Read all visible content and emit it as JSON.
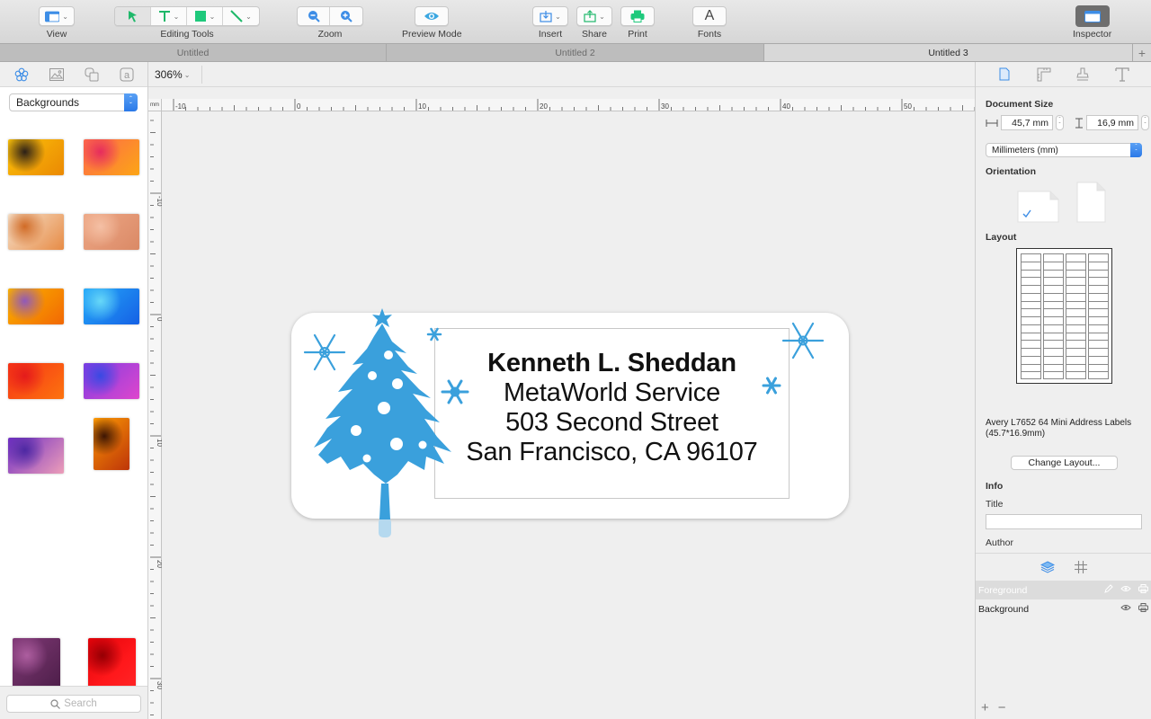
{
  "toolbar": {
    "groups": [
      {
        "label": "View"
      },
      {
        "label": "Editing Tools"
      },
      {
        "label": "Zoom"
      },
      {
        "label": "Preview Mode"
      },
      {
        "label": "Insert"
      },
      {
        "label": "Share"
      },
      {
        "label": "Print"
      },
      {
        "label": "Fonts"
      },
      {
        "label": "Inspector"
      }
    ],
    "fonts_glyph": "A"
  },
  "tabs": [
    {
      "label": "Untitled",
      "active": false
    },
    {
      "label": "Untitled 2",
      "active": false
    },
    {
      "label": "Untitled 3",
      "active": true
    }
  ],
  "tab_add": "+",
  "left_sidebar": {
    "tabs": [
      "shapes-flower",
      "images",
      "layers-copy",
      "text-a"
    ],
    "category": "Backgrounds",
    "thumbnails": [
      {
        "name": "yellow-orange-stroke",
        "colors": [
          "#f6c21a",
          "#e38a10",
          "#2a1f18"
        ]
      },
      {
        "name": "pink-orange-stripes",
        "colors": [
          "#f36a52",
          "#f5a623",
          "#d9305d"
        ]
      },
      {
        "name": "orange-speckle",
        "colors": [
          "#f4e3cf",
          "#e08c4d",
          "#c96c2e"
        ]
      },
      {
        "name": "peach-wood",
        "colors": [
          "#e8a98a",
          "#d48a6a",
          "#f1c1a8"
        ]
      },
      {
        "name": "yellow-purple-flame",
        "colors": [
          "#f5b40b",
          "#e76a10",
          "#8d5bb3"
        ]
      },
      {
        "name": "blue-watercolor",
        "colors": [
          "#2fa8f0",
          "#1b5fd8",
          "#6fd6f3"
        ]
      },
      {
        "name": "red-orange",
        "colors": [
          "#e8371c",
          "#f2751a",
          "#d61f1f"
        ]
      },
      {
        "name": "purple-blue",
        "colors": [
          "#7a3fd6",
          "#d54ac4",
          "#3b4ad6"
        ]
      },
      {
        "name": "purple-floral",
        "colors": [
          "#6b2fb8",
          "#e8a0b8",
          "#4b2a99"
        ]
      },
      {
        "name": "sunset-tree",
        "colors": [
          "#f39a12",
          "#b3370f",
          "#3a1606"
        ]
      },
      {
        "name": "purple-crosshatch",
        "colors": [
          "#7b3b73",
          "#4a1f46",
          "#a8609b"
        ]
      },
      {
        "name": "red-silk",
        "colors": [
          "#d4060d",
          "#ff2a2a",
          "#8a0006"
        ]
      }
    ],
    "search_placeholder": "Search"
  },
  "canvas": {
    "zoom": "306%",
    "ruler_unit": "mm",
    "h_ruler_labels": [
      "-10",
      "0",
      "10",
      "20",
      "30",
      "40",
      "50"
    ],
    "v_ruler_labels": [
      "-10",
      "0",
      "10",
      "20",
      "30"
    ],
    "label_text": {
      "name": "Kenneth L. Sheddan",
      "company": "MetaWorld Service",
      "street": "503 Second Street",
      "city": "San Francisco, CA 96107"
    },
    "art_color": "#3aa0dc"
  },
  "inspector": {
    "tabs": [
      "document",
      "ruler",
      "stamp",
      "text"
    ],
    "document_size_title": "Document Size",
    "width": "45,7 mm",
    "height": "16,9 mm",
    "units": "Millimeters (mm)",
    "orientation_title": "Orientation",
    "orientation_selected": "landscape",
    "layout_title": "Layout",
    "layout_grid": {
      "columns": 4,
      "rows": 16
    },
    "layout_name": "Avery L7652 64 Mini Address Labels (45.7*16.9mm)",
    "change_layout": "Change Layout...",
    "info_title": "Info",
    "title_label": "Title",
    "title_value": "",
    "author_label": "Author",
    "author_value": "",
    "layers": [
      {
        "name": "Foreground",
        "selected": true,
        "editable": true
      },
      {
        "name": "Background",
        "selected": false,
        "editable": false
      }
    ],
    "add": "+",
    "remove": "−"
  }
}
